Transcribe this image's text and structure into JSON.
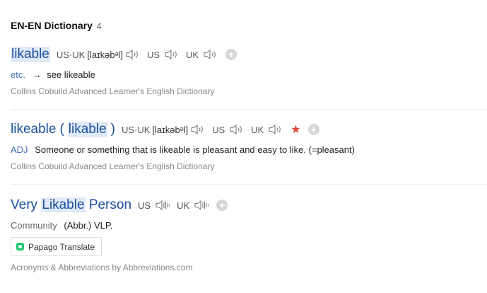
{
  "header": {
    "title": "EN-EN Dictionary",
    "count": "4"
  },
  "entries": [
    {
      "word": "likable",
      "phonetic_label": "US·UK",
      "phonetic": "[laɪkəbᵊl]",
      "us_label": "US",
      "uk_label": "UK",
      "pos": "etc.",
      "definition": "see likeable",
      "arrow": "→",
      "source": "Collins Cobuild Advanced Learner's English Dictionary"
    },
    {
      "word": "likeable",
      "variant_open": "(",
      "variant": "likable",
      "variant_close": ")",
      "phonetic_label": "US·UK",
      "phonetic": "[laɪkəbᵊl]",
      "us_label": "US",
      "uk_label": "UK",
      "star": "★",
      "pos": "ADJ",
      "definition": "Someone or something that is likeable is pleasant and easy to like. (=pleasant)",
      "source": "Collins Cobuild Advanced Learner's English Dictionary"
    },
    {
      "word_pre": "Very",
      "word_hl": "Likable",
      "word_post": "Person",
      "us_label": "US",
      "uk_label": "UK",
      "pos": "Community",
      "definition": "(Abbr.) VLP.",
      "papago_label": "Papago Translate",
      "source": "Acronyms & Abbreviations by Abbreviations.com"
    }
  ],
  "plus_symbol": "+",
  "colors": {
    "link": "#1a4fa0",
    "highlight": "#dfe9f7",
    "star": "#e0463a",
    "papago": "#1ec771"
  }
}
